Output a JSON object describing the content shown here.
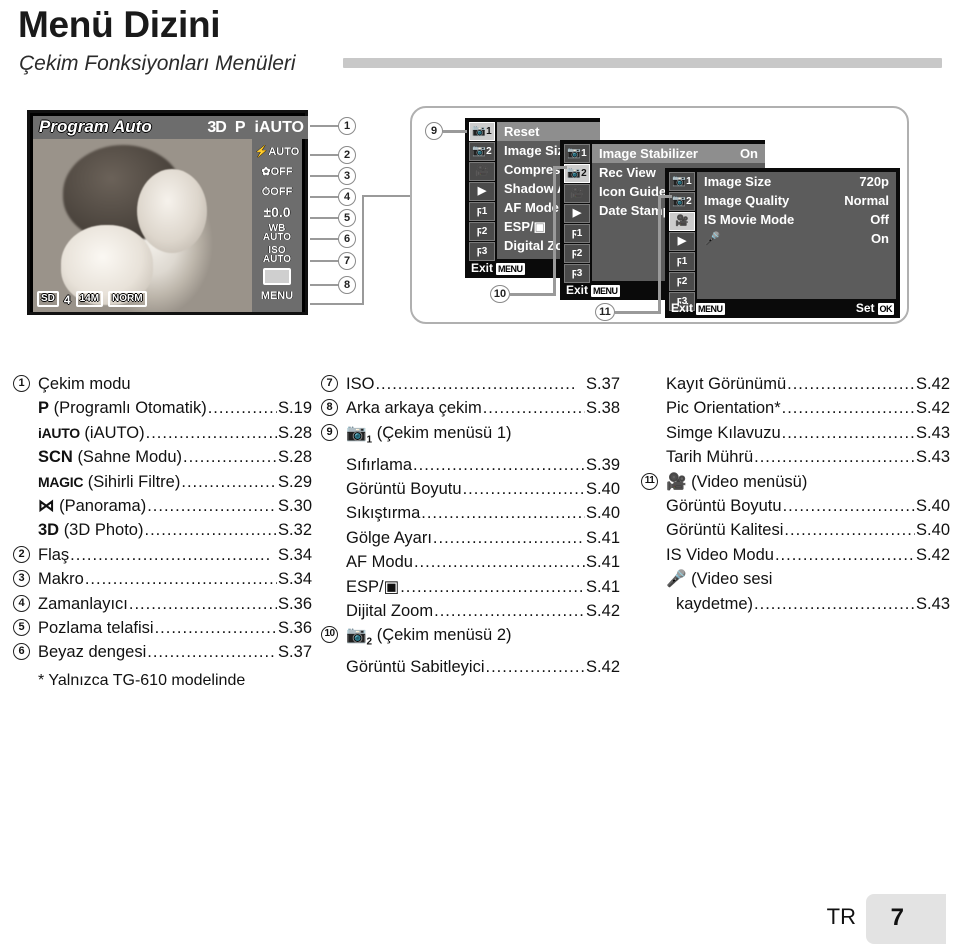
{
  "header": {
    "title": "Menü Dizini",
    "subtitle": "Çekim Fonksiyonları Menüleri"
  },
  "figure": {
    "lcd": {
      "mode_label": "Program Auto",
      "top_icons": [
        "3D",
        "P",
        "iAUTO"
      ],
      "side_items": [
        {
          "name": "flash-auto",
          "text": "AUTO",
          "prefix": "flash"
        },
        {
          "name": "macro-off",
          "text": "OFF",
          "prefix": "macro"
        },
        {
          "name": "selftimer-off",
          "text": "OFF",
          "prefix": "timer"
        },
        {
          "name": "exposure-comp",
          "text": "±0.0"
        },
        {
          "name": "white-balance",
          "line1": "WB",
          "line2": "AUTO"
        },
        {
          "name": "iso",
          "line1": "ISO",
          "line2": "AUTO"
        },
        {
          "name": "drive-mode",
          "text": ""
        },
        {
          "name": "menu",
          "text": "MENU"
        }
      ],
      "bottom_items": [
        "SD",
        "4",
        "14M",
        "NORM"
      ]
    },
    "callouts": [
      "1",
      "2",
      "3",
      "4",
      "5",
      "6",
      "7",
      "8",
      "9",
      "10",
      "11"
    ],
    "menus": [
      {
        "id": "shooting-menu-1",
        "tabs": [
          "camera1",
          "camera2",
          "movie",
          "playback",
          "setup1",
          "setup2",
          "setup3"
        ],
        "selected_tab": 0,
        "rows": [
          {
            "label": "Reset",
            "value": "",
            "selected": true
          },
          {
            "label": "Image Size",
            "value": ""
          },
          {
            "label": "Compression",
            "value": ""
          },
          {
            "label": "Shadow Adjust",
            "value": ""
          },
          {
            "label": "AF Mode",
            "value": ""
          },
          {
            "label": "ESP/▣",
            "value": ""
          },
          {
            "label": "Digital Zoom",
            "value": ""
          }
        ],
        "exit_label": "Exit",
        "exit_key": "MENU"
      },
      {
        "id": "shooting-menu-2",
        "tabs": [
          "camera1",
          "camera2",
          "movie",
          "playback",
          "setup1",
          "setup2",
          "setup3"
        ],
        "selected_tab": 1,
        "rows": [
          {
            "label": "Image Stabilizer",
            "value": "On",
            "selected": true
          },
          {
            "label": "Rec View",
            "value": ""
          },
          {
            "label": "Icon Guide",
            "value": ""
          },
          {
            "label": "Date Stamp",
            "value": ""
          }
        ],
        "exit_label": "Exit",
        "exit_key": "MENU"
      },
      {
        "id": "movie-menu",
        "tabs": [
          "camera1",
          "camera2",
          "movie",
          "playback",
          "setup1",
          "setup2",
          "setup3"
        ],
        "selected_tab": 2,
        "rows": [
          {
            "label": "Image Size",
            "value": "720p"
          },
          {
            "label": "Image Quality",
            "value": "Normal"
          },
          {
            "label": "IS Movie Mode",
            "value": "Off"
          },
          {
            "label": "·mic·",
            "value": "On"
          }
        ],
        "exit_label": "Exit",
        "exit_key": "MENU",
        "set_label": "Set",
        "set_key": "OK"
      }
    ]
  },
  "index": {
    "columns": [
      {
        "entries": [
          {
            "num": "1",
            "name": "Çekim modu",
            "page": "",
            "dots": false
          },
          {
            "glyph": "P",
            "name": "(Programlı Otomatik)",
            "page": "S.19",
            "indent": true
          },
          {
            "glyph": "iAUTO",
            "name": "(iAUTO)",
            "page": "S.28",
            "indent": true
          },
          {
            "glyph": "SCN",
            "name": "(Sahne Modu)",
            "page": "S.28",
            "indent": true
          },
          {
            "glyph": "MAGIC",
            "name": "(Sihirli Filtre)",
            "page": "S.29",
            "indent": true
          },
          {
            "glyph": "⋈",
            "name": "(Panorama)",
            "page": "S.30",
            "indent": true
          },
          {
            "glyph": "3D",
            "name": "(3D Photo)",
            "page": "S.32",
            "indent": true
          },
          {
            "num": "2",
            "name": "Flaş",
            "page": "S.34"
          },
          {
            "num": "3",
            "name": "Makro",
            "page": "S.34"
          },
          {
            "num": "4",
            "name": "Zamanlayıcı",
            "page": "S.36"
          },
          {
            "num": "5",
            "name": "Pozlama telafisi",
            "page": "S.36"
          },
          {
            "num": "6",
            "name": "Beyaz dengesi",
            "page": "S.37"
          }
        ]
      },
      {
        "entries": [
          {
            "num": "7",
            "name": "ISO",
            "page": "S.37"
          },
          {
            "num": "8",
            "name": "Arka arkaya çekim",
            "page": "S.38"
          },
          {
            "num": "9",
            "glyph": "cam1",
            "name": "(Çekim menüsü 1)",
            "page": "",
            "dots": false
          },
          {
            "name": "Sıfırlama",
            "page": "S.39",
            "indent": true
          },
          {
            "name": "Görüntü Boyutu",
            "page": "S.40",
            "indent": true
          },
          {
            "name": "Sıkıştırma",
            "page": "S.40",
            "indent": true
          },
          {
            "name": "Gölge Ayarı",
            "page": "S.41",
            "indent": true
          },
          {
            "name": "AF Modu",
            "page": "S.41",
            "indent": true
          },
          {
            "name": "ESP/▣",
            "page": "S.41",
            "indent": true
          },
          {
            "name": "Dijital Zoom",
            "page": "S.42",
            "indent": true
          },
          {
            "num": "10",
            "glyph": "cam2",
            "name": "(Çekim menüsü 2)",
            "page": "",
            "dots": false
          },
          {
            "name": "Görüntü Sabitleyici",
            "page": "S.42",
            "indent": true
          }
        ]
      },
      {
        "entries": [
          {
            "name": "Kayıt Görünümü",
            "page": "S.42",
            "indent": true
          },
          {
            "name": "Pic Orientation*",
            "page": "S.42",
            "indent": true
          },
          {
            "name": "Simge Kılavuzu",
            "page": "S.43",
            "indent": true
          },
          {
            "name": "Tarih Mührü",
            "page": "S.43",
            "indent": true
          },
          {
            "num": "11",
            "glyph": "movie",
            "name": "(Video menüsü)",
            "page": "",
            "dots": false
          },
          {
            "name": "Görüntü Boyutu",
            "page": "S.40",
            "indent": true
          },
          {
            "name": "Görüntü Kalitesi",
            "page": "S.40",
            "indent": true
          },
          {
            "name": "IS Video Modu",
            "page": "S.42",
            "indent": true
          },
          {
            "glyph": "mic",
            "name": "(Video sesi",
            "page": "",
            "dots": false,
            "indent": true
          },
          {
            "name": "kaydetme)",
            "page": "S.43",
            "indent": true,
            "extra_indent": true
          }
        ]
      }
    ]
  },
  "footnote": "* Yalnızca TG-610 modelinde",
  "footer": {
    "locale": "TR",
    "page_number": "7"
  }
}
